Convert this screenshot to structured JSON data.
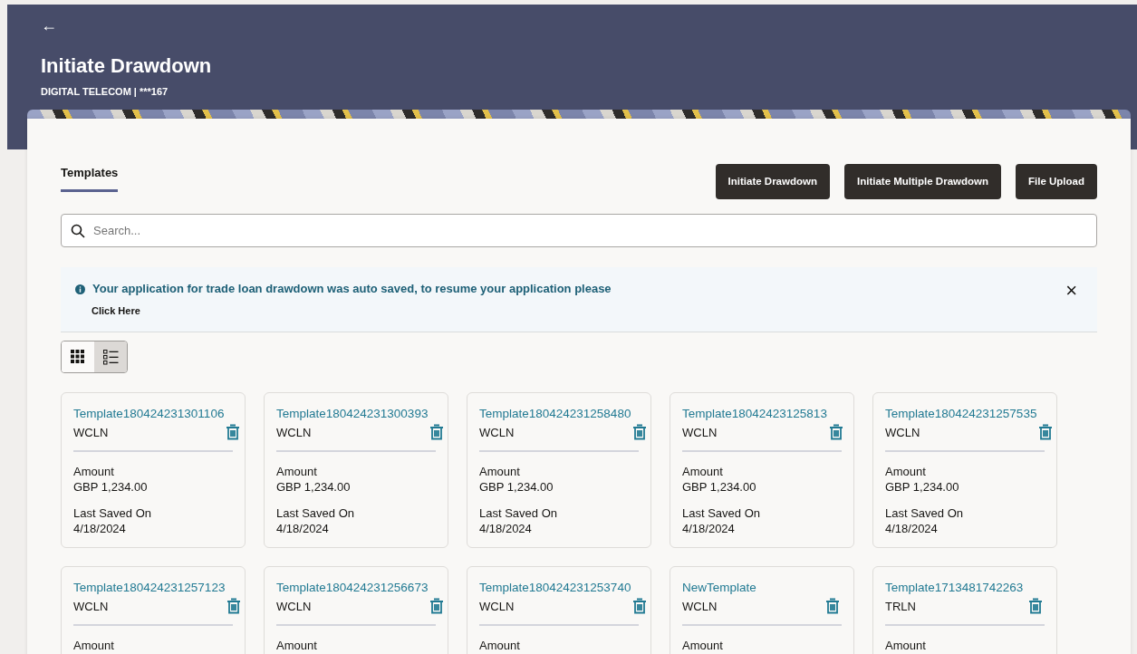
{
  "header": {
    "back": "←",
    "title": "Initiate Drawdown",
    "subtitle": "DIGITAL TELECOM | ***167"
  },
  "tabs": [
    {
      "label": "Templates",
      "selected": true
    }
  ],
  "actions": [
    "Initiate Drawdown",
    "Initiate Multiple Drawdown",
    "File Upload"
  ],
  "search": {
    "placeholder": "Search..."
  },
  "notice": {
    "message": "Your application for trade loan drawdown was auto saved, to resume your application please",
    "link": "Click Here",
    "close": "×"
  },
  "view_toggle": [
    {
      "kind": "grid",
      "selected": false
    },
    {
      "kind": "list",
      "selected": true
    }
  ],
  "templates": [
    {
      "title": "Template180424231301106",
      "product": "WCLN",
      "fields": [
        {
          "label": "Amount",
          "value": "GBP 1,234.00"
        },
        {
          "label": "Last Saved On",
          "value": "4/18/2024"
        }
      ]
    },
    {
      "title": "Template180424231300393",
      "product": "WCLN",
      "fields": [
        {
          "label": "Amount",
          "value": "GBP 1,234.00"
        },
        {
          "label": "Last Saved On",
          "value": "4/18/2024"
        }
      ]
    },
    {
      "title": "Template180424231258480",
      "product": "WCLN",
      "fields": [
        {
          "label": "Amount",
          "value": "GBP 1,234.00"
        },
        {
          "label": "Last Saved On",
          "value": "4/18/2024"
        }
      ]
    },
    {
      "title": "Template18042423125813",
      "product": "WCLN",
      "fields": [
        {
          "label": "Amount",
          "value": "GBP 1,234.00"
        },
        {
          "label": "Last Saved On",
          "value": "4/18/2024"
        }
      ]
    },
    {
      "title": "Template180424231257535",
      "product": "WCLN",
      "fields": [
        {
          "label": "Amount",
          "value": "GBP 1,234.00"
        },
        {
          "label": "Last Saved On",
          "value": "4/18/2024"
        }
      ]
    },
    {
      "title": "Template180424231257123",
      "product": "WCLN",
      "fields": [
        {
          "label": "Amount"
        }
      ]
    },
    {
      "title": "Template180424231256673",
      "product": "WCLN",
      "fields": [
        {
          "label": "Amount"
        }
      ]
    },
    {
      "title": "Template180424231253740",
      "product": "WCLN",
      "fields": [
        {
          "label": "Amount"
        }
      ]
    },
    {
      "title": "NewTemplate",
      "product": "WCLN",
      "fields": [
        {
          "label": "Amount"
        }
      ]
    },
    {
      "title": "Template1713481742263",
      "product": "TRLN",
      "fields": [
        {
          "label": "Amount"
        }
      ]
    }
  ]
}
